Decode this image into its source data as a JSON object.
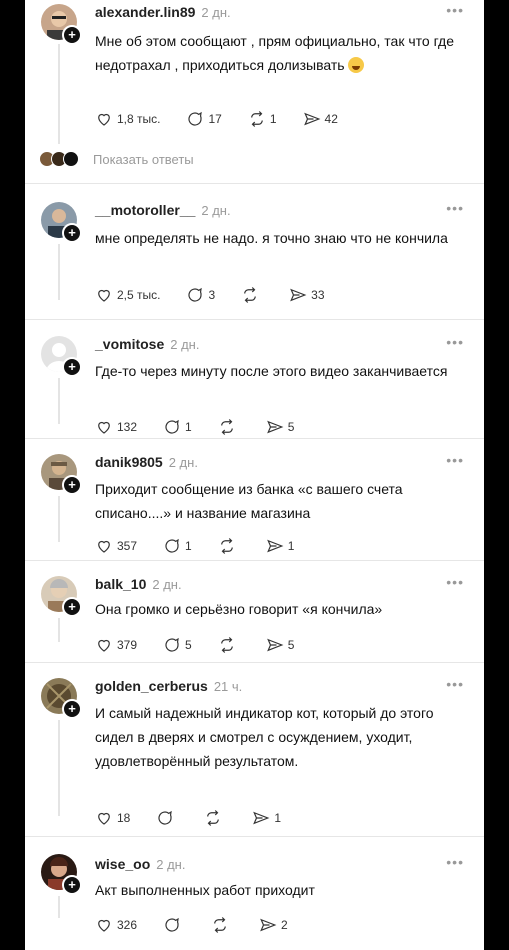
{
  "ui": {
    "show_replies_label": "Показать ответы"
  },
  "posts": [
    {
      "username": "alexander.lin89",
      "time": "2 дн.",
      "text": "Мне об этом сообщают , прям официально, так что где недотрахал , приходиться долизывать",
      "emoji": "grinning-sweat-emoji",
      "likes": "1,8 тыс.",
      "comments": "17",
      "reposts": "1",
      "shares": "42",
      "avatar_color": "#d9b89a"
    },
    {
      "username": "__motoroller__",
      "time": "2 дн.",
      "text": "мне определять не надо. я точно знаю что не кончила",
      "likes": "2,5 тыс.",
      "comments": "3",
      "reposts": "",
      "shares": "33",
      "avatar_color": "#4a5a6b"
    },
    {
      "username": "_vomitose",
      "time": "2 дн.",
      "text": "Где-то через минуту после этого видео заканчивается",
      "likes": "132",
      "comments": "1",
      "reposts": "",
      "shares": "5",
      "avatar_color": "#dcdcdc"
    },
    {
      "username": "danik9805",
      "time": "2 дн.",
      "text": "Приходит сообщение из банка «с вашего счета списано....» и название магазина",
      "likes": "357",
      "comments": "1",
      "reposts": "",
      "shares": "1",
      "avatar_color": "#8b7a62"
    },
    {
      "username": "balk_10",
      "time": "2 дн.",
      "text": "Она громко и серьёзно говорит «я кончила»",
      "likes": "379",
      "comments": "5",
      "reposts": "",
      "shares": "5",
      "avatar_color": "#b9a28a"
    },
    {
      "username": "golden_cerberus",
      "time": "21 ч.",
      "text": "И самый надежный индикатор  кот, который до этого сидел в дверях и смотрел с осуждением, уходит, удовлетворённый результатом.",
      "likes": "18",
      "comments": "",
      "reposts": "",
      "shares": "1",
      "avatar_color": "#6b5a3e"
    },
    {
      "username": "wise_oo",
      "time": "2 дн.",
      "text": "Акт выполненных работ приходит",
      "likes": "326",
      "comments": "",
      "reposts": "",
      "shares": "2",
      "avatar_color": "#8a3a2a"
    }
  ]
}
